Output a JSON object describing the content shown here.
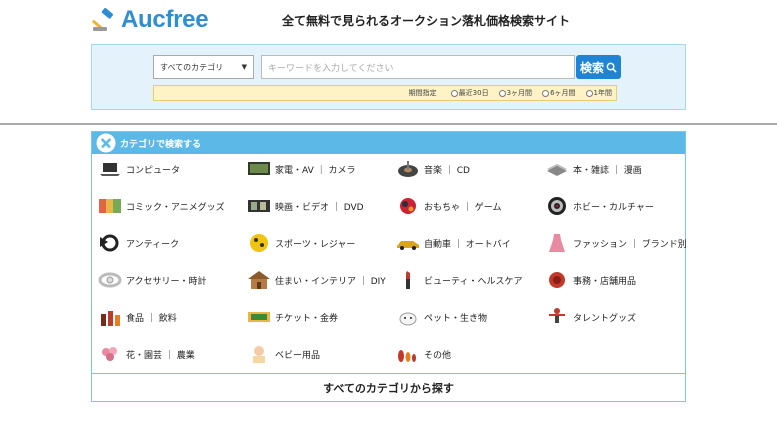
{
  "header": {
    "logo_text": "Aucfree",
    "tagline": "全て無料で見られるオークション落札価格検索サイト"
  },
  "search": {
    "category_value": "すべてのカテゴリ",
    "keyword_placeholder": "キーワードを入力してください",
    "button_label": "検索",
    "period_label": "期間指定",
    "period_options": [
      "最近30日",
      "3ヶ月間",
      "6ヶ月間",
      "1年間"
    ]
  },
  "categories": {
    "header_title": "カテゴリで検索する",
    "footer_link": "すべてのカテゴリから探す",
    "items": [
      {
        "label": "コンピュータ",
        "icon": "laptop-icon"
      },
      {
        "label": "家電・AV ｜ カメラ",
        "icon": "tv-icon"
      },
      {
        "label": "音楽 ｜ CD",
        "icon": "record-icon"
      },
      {
        "label": "本・雑誌 ｜ 漫画",
        "icon": "book-icon"
      },
      {
        "label": "コミック・アニメグッズ",
        "icon": "comic-icon"
      },
      {
        "label": "映画・ビデオ ｜ DVD",
        "icon": "film-icon"
      },
      {
        "label": "おもちゃ ｜ ゲーム",
        "icon": "toy-icon"
      },
      {
        "label": "ホビー・カルチャー",
        "icon": "dartboard-icon"
      },
      {
        "label": "アンティーク",
        "icon": "gramophone-icon"
      },
      {
        "label": "スポーツ・レジャー",
        "icon": "ball-icon"
      },
      {
        "label": "自動車 ｜ オートバイ",
        "icon": "car-icon"
      },
      {
        "label": "ファッション ｜ ブランド別",
        "icon": "dress-icon"
      },
      {
        "label": "アクセサリー・時計",
        "icon": "watch-icon"
      },
      {
        "label": "住まい・インテリア ｜ DIY",
        "icon": "house-icon"
      },
      {
        "label": "ビューティ・ヘルスケア",
        "icon": "lipstick-icon"
      },
      {
        "label": "事務・店舗用品",
        "icon": "stamp-icon"
      },
      {
        "label": "食品 ｜ 飲料",
        "icon": "bottles-icon"
      },
      {
        "label": "チケット・金券",
        "icon": "ticket-icon"
      },
      {
        "label": "ペット・生き物",
        "icon": "dog-icon"
      },
      {
        "label": "タレントグッズ",
        "icon": "star-figure-icon"
      },
      {
        "label": "花・園芸 ｜ 農業",
        "icon": "flower-icon"
      },
      {
        "label": "ベビー用品",
        "icon": "baby-icon"
      },
      {
        "label": "その他",
        "icon": "dolls-icon"
      }
    ]
  }
}
